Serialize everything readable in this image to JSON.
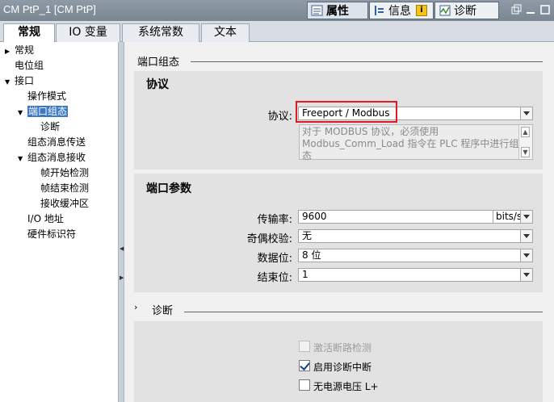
{
  "window": {
    "title": "CM PtP_1 [CM PtP]",
    "inspector_tabs": [
      {
        "label": "属性",
        "icon": "properties-icon"
      },
      {
        "label": "信息",
        "icon": "info-icon"
      },
      {
        "label": "诊断",
        "icon": "diagnostics-icon"
      }
    ],
    "info_badge": "i"
  },
  "tabs": [
    "常规",
    "IO 变量",
    "系统常数",
    "文本"
  ],
  "nav": {
    "items": [
      {
        "label": "常规"
      },
      {
        "label": "电位组"
      },
      {
        "label": "接口"
      },
      {
        "label": "操作模式"
      },
      {
        "label": "端口组态"
      },
      {
        "label": "诊断"
      },
      {
        "label": "组态消息传送"
      },
      {
        "label": "组态消息接收"
      },
      {
        "label": "帧开始检测"
      },
      {
        "label": "帧结束检测"
      },
      {
        "label": "接收缓冲区"
      },
      {
        "label": "I/O 地址"
      },
      {
        "label": "硬件标识符"
      }
    ],
    "selected": "端口组态"
  },
  "port_config": {
    "section_title": "端口组态",
    "protocol": {
      "panel_title": "协议",
      "label": "协议:",
      "value": "Freeport / Modbus",
      "info_line1": "对于 MODBUS 协议，必须使用",
      "info_line2": "Modbus_Comm_Load 指令在 PLC 程序中进行组",
      "info_line3": "态"
    },
    "params": {
      "panel_title": "端口参数",
      "baud_label": "传输率:",
      "baud_value": "9600",
      "baud_unit": "bits/s",
      "parity_label": "奇偶校验:",
      "parity_value": "无",
      "databits_label": "数据位:",
      "databits_value": "8 位",
      "stopbits_label": "结束位:",
      "stopbits_value": "1"
    }
  },
  "diagnostics": {
    "section_title": "诊断",
    "options": [
      {
        "label": "激活断路检测",
        "checked": false,
        "enabled": false
      },
      {
        "label": "启用诊断中断",
        "checked": true,
        "enabled": true
      },
      {
        "label": "无电源电压 L+",
        "checked": false,
        "enabled": true
      }
    ]
  },
  "colors": {
    "selection": "#3a78c3",
    "highlight_border": "#e01b24",
    "panel_bg": "#e2e2e2"
  }
}
